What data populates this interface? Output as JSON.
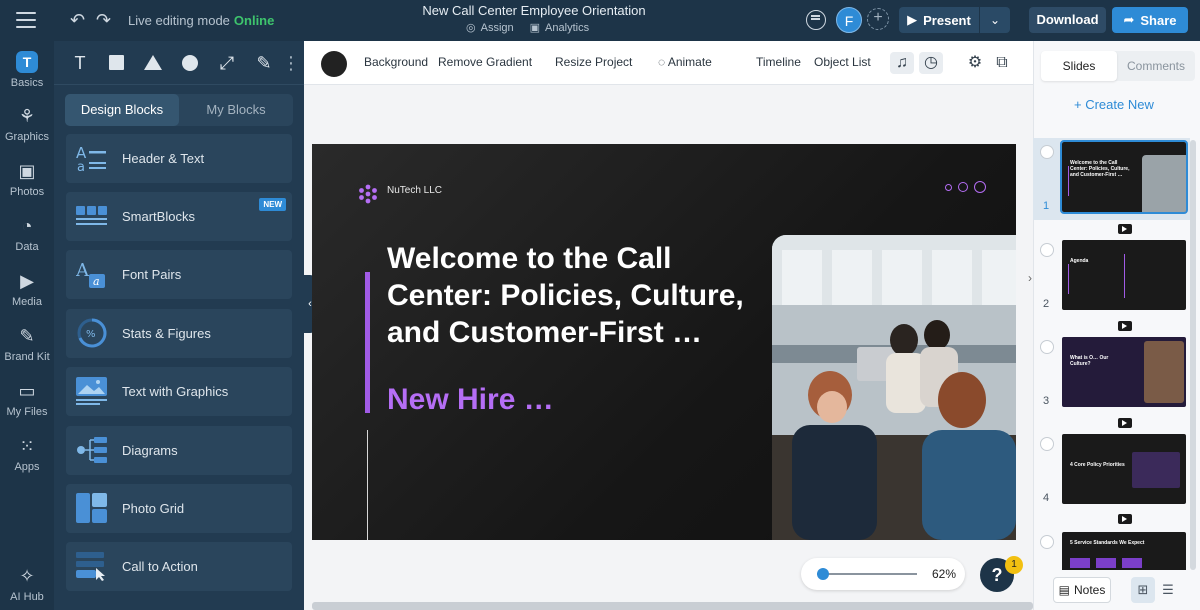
{
  "topbar": {
    "mode_label": "Live editing mode",
    "status": "Online",
    "doc_title": "New Call Center Employee Orientation",
    "assign": "Assign",
    "analytics": "Analytics",
    "avatar_initial": "F",
    "present": "Present",
    "download": "Download",
    "share": "Share"
  },
  "rail": [
    {
      "label": "Basics",
      "icon": "T"
    },
    {
      "label": "Graphics",
      "icon": "graphics-icon"
    },
    {
      "label": "Photos",
      "icon": "photos-icon"
    },
    {
      "label": "Data",
      "icon": "data-icon"
    },
    {
      "label": "Media",
      "icon": "media-icon"
    },
    {
      "label": "Brand Kit",
      "icon": "brand-kit-icon"
    },
    {
      "label": "My Files",
      "icon": "folder-icon"
    },
    {
      "label": "Apps",
      "icon": "apps-icon"
    },
    {
      "label": "AI Hub",
      "icon": "sparkle-icon"
    }
  ],
  "panel": {
    "tabs": [
      "Design Blocks",
      "My Blocks"
    ],
    "blocks": [
      {
        "label": "Header & Text"
      },
      {
        "label": "SmartBlocks",
        "badge": "NEW"
      },
      {
        "label": "Font Pairs"
      },
      {
        "label": "Stats & Figures"
      },
      {
        "label": "Text with Graphics"
      },
      {
        "label": "Diagrams"
      },
      {
        "label": "Photo Grid"
      },
      {
        "label": "Call to Action"
      }
    ]
  },
  "toolbar": {
    "background": "Background",
    "remove_gradient": "Remove Gradient",
    "resize_project": "Resize Project",
    "animate": "Animate",
    "timeline": "Timeline",
    "object_list": "Object List"
  },
  "slide": {
    "brand": "NuTech LLC",
    "title": "Welcome to the Call Center: Policies, Culture, and Customer-First …",
    "subtitle": "New Hire …"
  },
  "zoom": {
    "value": "62%",
    "level": 0.62
  },
  "help": {
    "label": "?",
    "badge": "1"
  },
  "right_panel": {
    "tabs": [
      "Slides",
      "Comments"
    ],
    "create_new": "+ Create New",
    "thumbnails": [
      {
        "number": "1",
        "title": "Welcome to the Call Center: Policies, Culture, and Customer-First …",
        "active": true
      },
      {
        "number": "2",
        "title": "Agenda"
      },
      {
        "number": "3",
        "title": "What is O… Our Culture?"
      },
      {
        "number": "4",
        "title": "4 Core Policy Priorities"
      },
      {
        "number": "",
        "title": "5 Service Standards We Expect"
      }
    ],
    "notes": "Notes"
  },
  "colors": {
    "topbar": "#1d3448",
    "accent_blue": "#2e8bd6",
    "online_green": "#3ec46d",
    "slide_purple": "#b56ef5"
  }
}
